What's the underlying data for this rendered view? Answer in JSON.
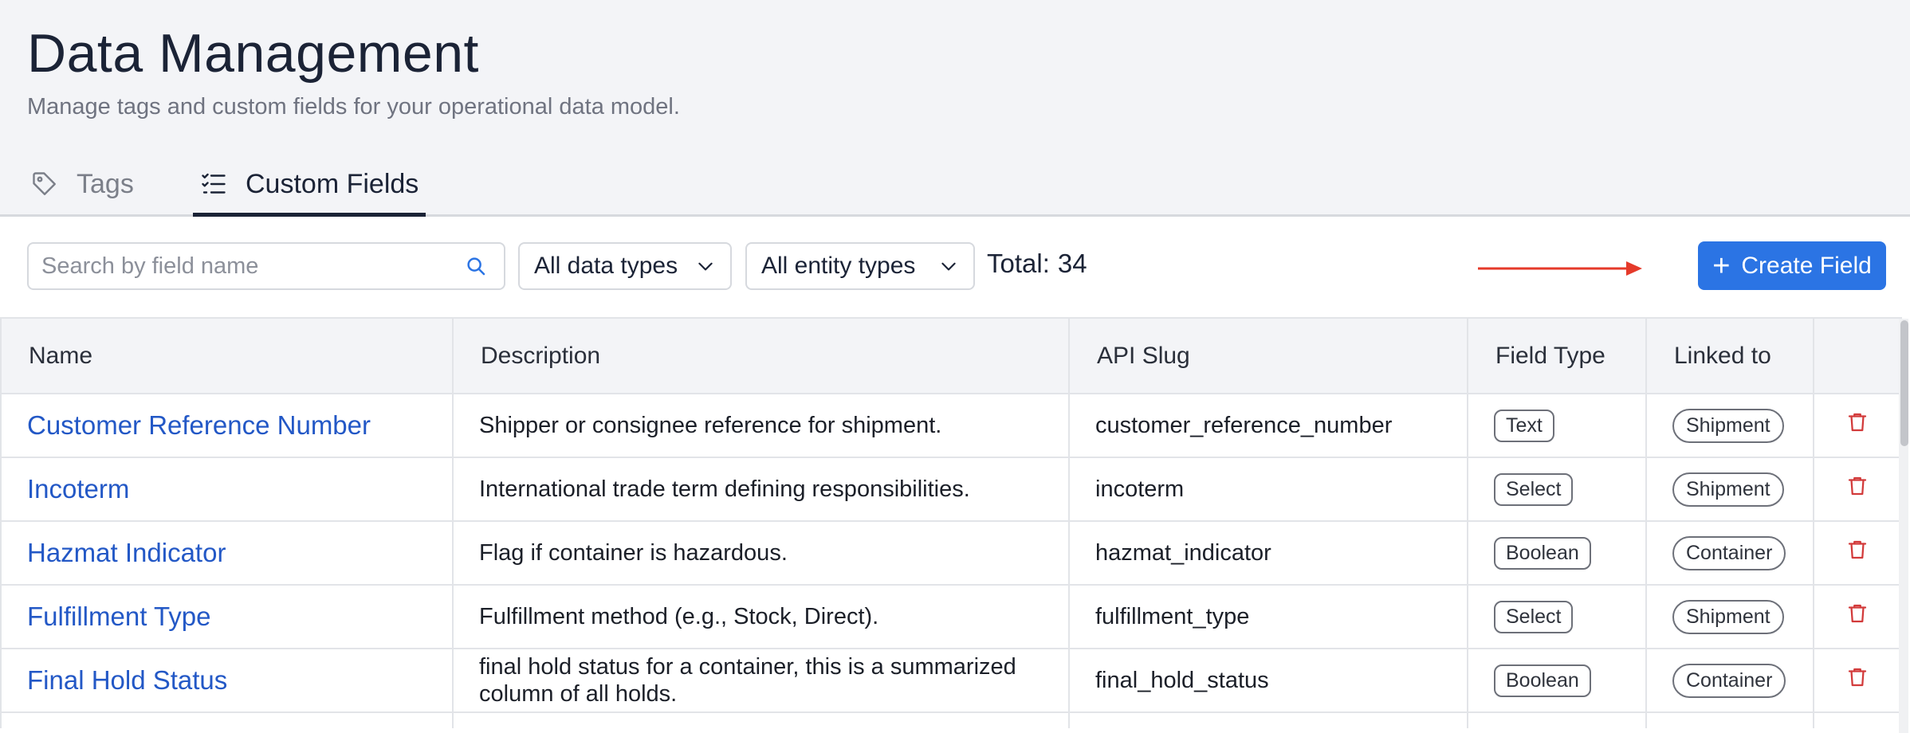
{
  "page": {
    "title": "Data Management",
    "subtitle": "Manage tags and custom fields for your operational data model."
  },
  "tabs": [
    {
      "label": "Tags",
      "icon": "tag-icon",
      "active": false
    },
    {
      "label": "Custom Fields",
      "icon": "checklist-icon",
      "active": true
    }
  ],
  "toolbar": {
    "search_placeholder": "Search by field name",
    "data_type_filter": "All data types",
    "entity_type_filter": "All entity types",
    "total_label": "Total:",
    "total_value": "34",
    "create_button_label": "Create Field"
  },
  "table": {
    "columns": [
      "Name",
      "Description",
      "API Slug",
      "Field Type",
      "Linked to",
      ""
    ],
    "rows": [
      {
        "name": "Customer Reference Number",
        "description": "Shipper or consignee reference for shipment.",
        "slug": "customer_reference_number",
        "type": "Text",
        "linked": "Shipment"
      },
      {
        "name": "Incoterm",
        "description": "International trade term defining responsibilities.",
        "slug": "incoterm",
        "type": "Select",
        "linked": "Shipment"
      },
      {
        "name": "Hazmat Indicator",
        "description": "Flag if container is hazardous.",
        "slug": "hazmat_indicator",
        "type": "Boolean",
        "linked": "Container"
      },
      {
        "name": "Fulfillment Type",
        "description": "Fulfillment method (e.g., Stock, Direct).",
        "slug": "fulfillment_type",
        "type": "Select",
        "linked": "Shipment"
      },
      {
        "name": "Final Hold Status",
        "description": "final hold status for a container, this is a summarized column of all holds.",
        "slug": "final_hold_status",
        "type": "Boolean",
        "linked": "Container"
      }
    ]
  },
  "colors": {
    "accent": "#2b74e4",
    "link": "#2358c6",
    "delete": "#d23a3a",
    "annotation_arrow": "#e53a2a"
  }
}
